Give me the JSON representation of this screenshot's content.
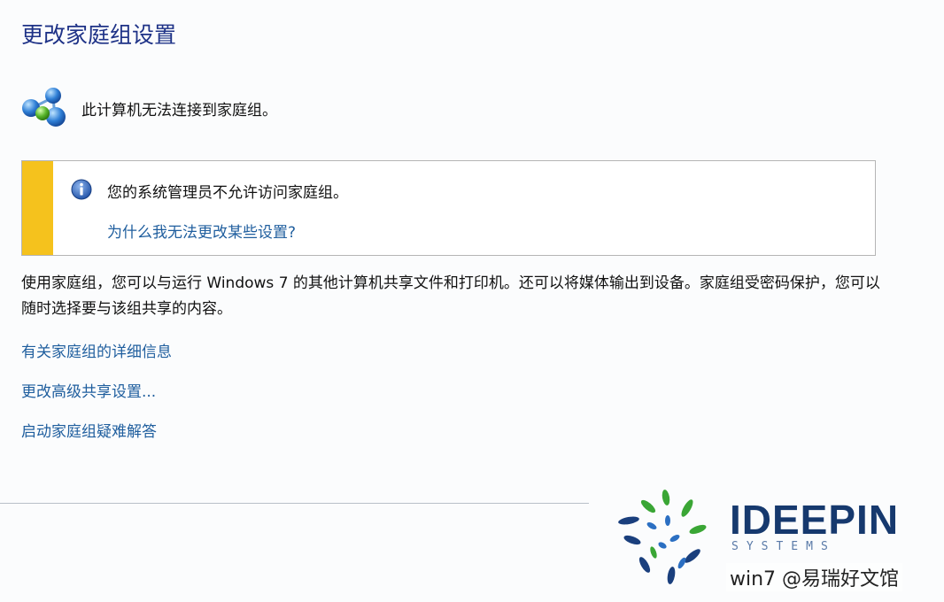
{
  "page": {
    "title": "更改家庭组设置",
    "status_text": "此计算机无法连接到家庭组。"
  },
  "notice": {
    "message": "您的系统管理员不允许访问家庭组。",
    "link": "为什么我无法更改某些设置?",
    "stripe_color": "#f5c21d",
    "icon": "info-icon"
  },
  "description": "使用家庭组，您可以与运行 Windows 7 的其他计算机共享文件和打印机。还可以将媒体输出到设备。家庭组受密码保护，您可以随时选择要与该组共享的内容。",
  "links": [
    {
      "label": "有关家庭组的详细信息"
    },
    {
      "label": "更改高级共享设置..."
    },
    {
      "label": "启动家庭组疑难解答"
    }
  ],
  "watermark": {
    "brand": "IDEEPIN",
    "subtitle": "SYSTEMS",
    "caption": "win7 @易瑞好文馆"
  },
  "colors": {
    "title": "#1e3287",
    "link": "#1f5e9e",
    "background": "#fbfcfd"
  }
}
